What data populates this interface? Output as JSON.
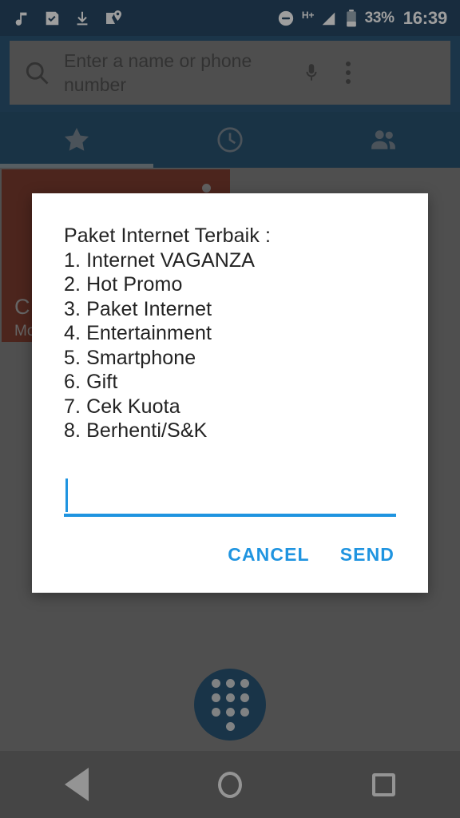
{
  "status_bar": {
    "left_icons": [
      "music-note-icon",
      "save-check-icon",
      "download-icon",
      "maps-pin-icon"
    ],
    "dnd_icon": "do-not-disturb-icon",
    "network_label": "H+",
    "signal_icon": "signal-bars-icon",
    "battery_icon": "battery-icon",
    "battery_percent": "33%",
    "time": "16:39"
  },
  "search": {
    "placeholder": "Enter a name or phone number",
    "value": "",
    "search_icon": "search-icon",
    "mic_icon": "microphone-icon",
    "overflow_icon": "overflow-menu-icon"
  },
  "tabs": [
    {
      "name": "favorites",
      "icon": "star-icon",
      "selected": true
    },
    {
      "name": "recents",
      "icon": "clock-icon",
      "selected": false
    },
    {
      "name": "contacts",
      "icon": "people-icon",
      "selected": false
    }
  ],
  "contact_card": {
    "name": "C",
    "subtitle": "Mo",
    "accent_color": "#6b2414"
  },
  "fab": {
    "icon": "dialpad-icon",
    "color": "#0d3f63"
  },
  "dialog": {
    "message": "Paket Internet Terbaik :\n1. Internet VAGANZA\n2. Hot Promo\n3. Paket Internet\n4. Entertainment\n5. Smartphone\n6. Gift\n7. Cek Kuota\n8. Berhenti/S&K",
    "input_value": "",
    "input_placeholder": "",
    "cancel_label": "CANCEL",
    "send_label": "SEND",
    "accent_color": "#1f94e0"
  },
  "nav_bar": {
    "back_label": "back-icon",
    "home_label": "home-icon",
    "recents_label": "recents-icon"
  },
  "colors": {
    "status_bar": "#0c3150",
    "toolbar": "#114064",
    "tab_strip": "#0d3c5d",
    "scrim": "#6b6b6b",
    "dialog_bg": "#ffffff",
    "accent_blue": "#1f94e0"
  }
}
